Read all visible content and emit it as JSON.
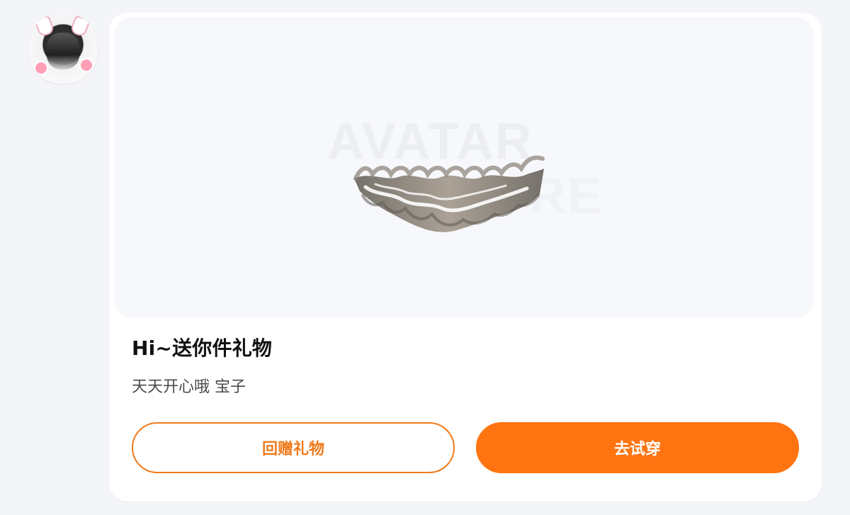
{
  "message": {
    "avatar_icon": "user-avatar-cat-ears-icon",
    "gift": {
      "preview_watermark_top": "AVATAR",
      "preview_watermark_bottom": "RE",
      "title": "Hi~送你件礼物",
      "subtitle": "天天开心哦 宝子"
    },
    "actions": {
      "return_gift_label": "回赠礼物",
      "try_on_label": "去试穿"
    }
  },
  "colors": {
    "accent": "#ff7410",
    "accent_outline": "#f07a1b",
    "background": "#f4f5f8",
    "card": "#ffffff",
    "preview_bg": "#f7f8fb"
  }
}
